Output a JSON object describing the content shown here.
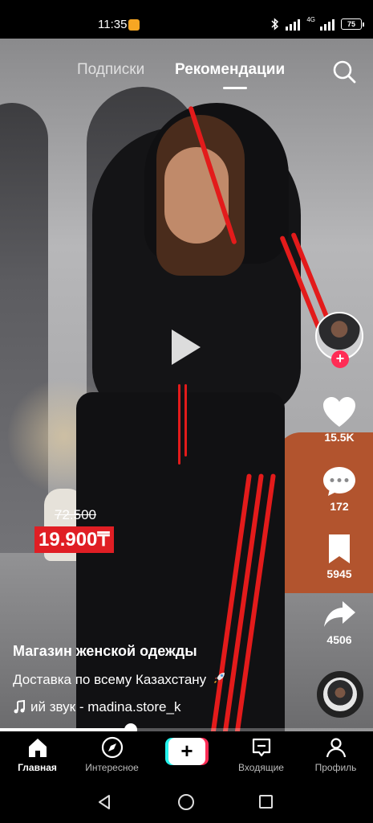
{
  "status_bar": {
    "time": "11:35",
    "network": "4G",
    "battery": "75"
  },
  "top_tabs": {
    "following": "Подписки",
    "for_you": "Рекомендации",
    "active": "for_you"
  },
  "video": {
    "old_price": "72.500",
    "new_price": "19.900₸",
    "play_icon": "play-icon"
  },
  "right_rail": {
    "likes": "15.5K",
    "comments": "172",
    "saves": "5945",
    "shares": "4506"
  },
  "caption": {
    "author": "Магазин женской одежды",
    "description": "Доставка по всему Казахстану",
    "sound": "ий звук - madina.store_k"
  },
  "progress": {
    "fraction": 0.35
  },
  "bottom_nav": {
    "home": "Главная",
    "discover": "Интересное",
    "create": "+",
    "inbox": "Входящие",
    "profile": "Профиль"
  },
  "colors": {
    "accent_red": "#e01e24",
    "follow_pink": "#fe2c55",
    "tiktok_cyan": "#25f4ee"
  }
}
